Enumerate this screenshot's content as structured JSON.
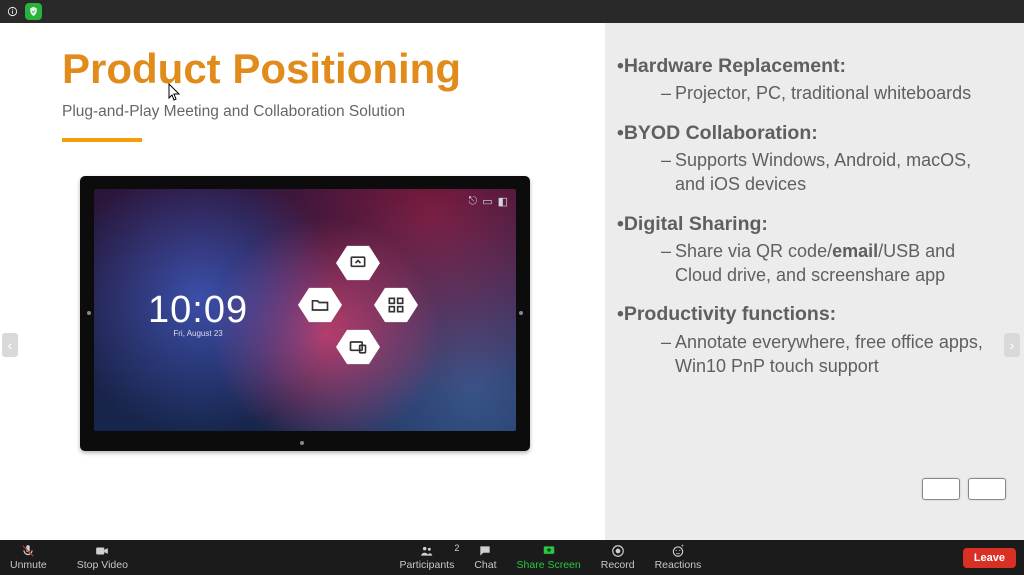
{
  "slide": {
    "title": "Product Positioning",
    "subtitle": "Plug-and-Play Meeting and Collaboration Solution",
    "display": {
      "clock": "10:09",
      "date": "Fri, August 23",
      "icons_tr": [
        "network-icon",
        "camera-icon",
        "wifi-icon"
      ],
      "hex_icons": [
        "screen-icon",
        "folder-icon",
        "apps-icon",
        "device-icon"
      ]
    },
    "points": [
      {
        "lead": "Hardware Replacement",
        "sub": "Projector, PC, traditional whiteboards"
      },
      {
        "lead": "BYOD Collaboration",
        "sub": "Supports Windows, Android, macOS, and iOS devices"
      },
      {
        "lead": "Digital Sharing",
        "sub_html": "Share via QR code/<b>email</b>/USB and Cloud drive, and screenshare app"
      },
      {
        "lead": "Productivity functions",
        "sub": "Annotate everywhere, free office apps, Win10 PnP touch support"
      }
    ]
  },
  "zoom": {
    "unmute": "Unmute",
    "stop_video": "Stop Video",
    "participants": "Participants",
    "participants_count": "2",
    "chat": "Chat",
    "share": "Share Screen",
    "record": "Record",
    "reactions": "Reactions",
    "leave": "Leave"
  }
}
